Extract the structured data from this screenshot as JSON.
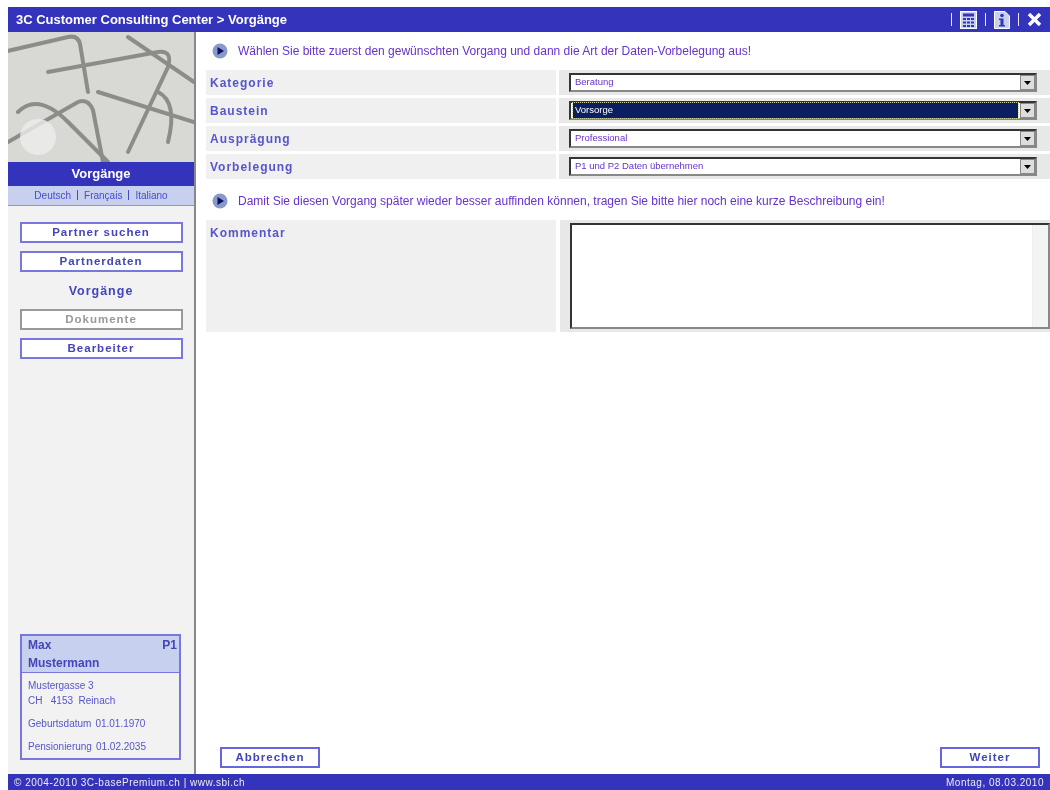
{
  "window": {
    "title": "3C Customer Consulting Center > Vorgänge"
  },
  "sidebar": {
    "heading": "Vorgänge",
    "languages": [
      "Deutsch",
      "Français",
      "Italiano"
    ],
    "items": [
      {
        "label": "Partner suchen",
        "selected": false,
        "disabled": false
      },
      {
        "label": "Partnerdaten",
        "selected": false,
        "disabled": false
      },
      {
        "label": "Vorgänge",
        "selected": true,
        "disabled": false
      },
      {
        "label": "Dokumente",
        "selected": false,
        "disabled": true
      },
      {
        "label": "Bearbeiter",
        "selected": false,
        "disabled": false
      }
    ],
    "person": {
      "first_name": "Max",
      "last_name": "Mustermann",
      "tag": "P1",
      "address": [
        "Mustergasse 3",
        "CH   4153  Reinach"
      ],
      "birth_label": "Geburtsdatum",
      "birth": "01.01.1970",
      "pension_label": "Pensionierung",
      "pension": "01.02.2035"
    }
  },
  "intro": "Wählen Sie bitte zuerst den gewünschten Vorgang und dann die Art der Daten-Vorbelegung aus!",
  "fields": [
    {
      "label": "Kategorie",
      "value": "Beratung",
      "focused": false
    },
    {
      "label": "Baustein",
      "value": "Vorsorge",
      "focused": true
    },
    {
      "label": "Ausprägung",
      "value": "Professional",
      "focused": false
    },
    {
      "label": "Vorbelegung",
      "value": "P1 und P2 Daten übernehmen",
      "focused": false
    }
  ],
  "hint": "Damit Sie diesen Vorgang später wieder besser auffinden können, tragen Sie bitte hier noch eine kurze Beschreibung ein!",
  "comment": {
    "label": "Kommentar"
  },
  "buttons": {
    "cancel": "Abbrechen",
    "next": "Weiter"
  },
  "status_bar": {
    "left": "© 2004-2010 3C-basePremium.ch | www.sbi.ch",
    "right": "Montag, 08.03.2010"
  }
}
